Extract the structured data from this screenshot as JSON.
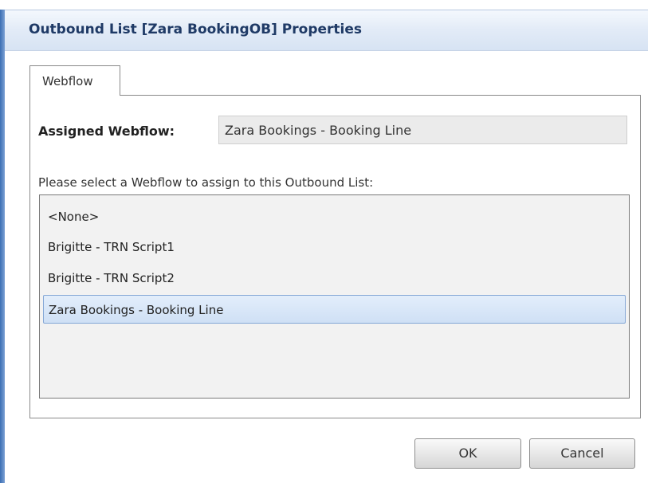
{
  "dialog": {
    "title": "Outbound List [Zara BookingOB] Properties"
  },
  "tabs": [
    {
      "label": "Webflow",
      "active": true
    }
  ],
  "webflow": {
    "assigned_label": "Assigned Webflow:",
    "assigned_value": "Zara Bookings - Booking Line",
    "prompt": "Please select a Webflow to assign to this Outbound List:",
    "options": [
      "<None>",
      "Brigitte - TRN Script1",
      "Brigitte - TRN Script2",
      "Zara Bookings - Booking Line"
    ],
    "selected_index": 3
  },
  "buttons": {
    "ok": "OK",
    "cancel": "Cancel"
  },
  "colors": {
    "title_text": "#1f3a66",
    "selection_border": "#84a7d6",
    "selection_fill": "#cfe0f5"
  }
}
